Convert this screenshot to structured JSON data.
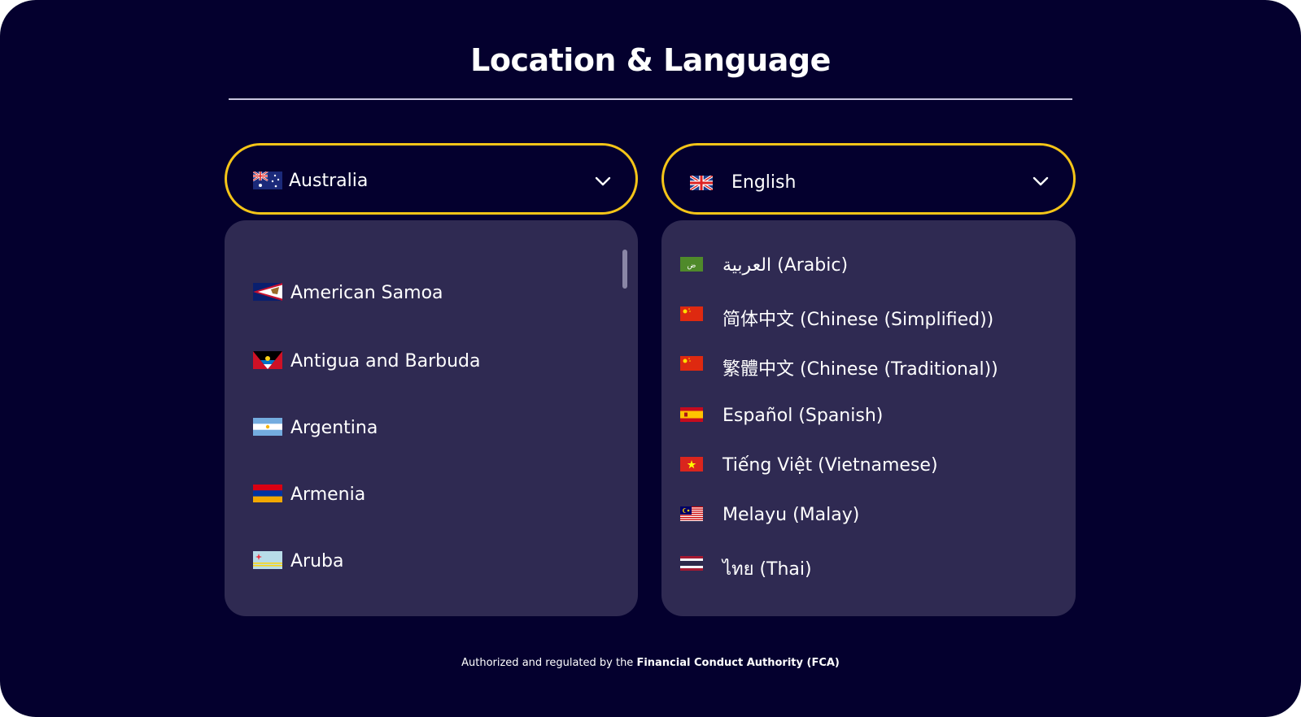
{
  "header": {
    "title": "Location & Language"
  },
  "country_select": {
    "selected": "Australia",
    "flag_icon": "australia-flag-icon"
  },
  "language_select": {
    "selected": "English",
    "flag_icon": "uk-flag-icon"
  },
  "country_list": {
    "items": [
      {
        "label": "American Samoa",
        "flag_icon": "american-samoa-flag-icon"
      },
      {
        "label": "Antigua and Barbuda",
        "flag_icon": "antigua-barbuda-flag-icon"
      },
      {
        "label": "Argentina",
        "flag_icon": "argentina-flag-icon"
      },
      {
        "label": "Armenia",
        "flag_icon": "armenia-flag-icon"
      },
      {
        "label": "Aruba",
        "flag_icon": "aruba-flag-icon"
      }
    ]
  },
  "language_list": {
    "items": [
      {
        "label": "العربية (Arabic)",
        "flag_icon": "arabic-flag-icon"
      },
      {
        "label": "简体中文 (Chinese (Simplified))",
        "flag_icon": "china-flag-icon"
      },
      {
        "label": "繁體中文 (Chinese (Traditional))",
        "flag_icon": "china-flag-icon"
      },
      {
        "label": "Español (Spanish)",
        "flag_icon": "spain-flag-icon"
      },
      {
        "label": "Tiếng Việt (Vietnamese)",
        "flag_icon": "vietnam-flag-icon"
      },
      {
        "label": "Melayu (Malay)",
        "flag_icon": "malaysia-flag-icon"
      },
      {
        "label": "ไทย (Thai)",
        "flag_icon": "thailand-flag-icon"
      }
    ]
  },
  "footer": {
    "prefix": "Authorized and regulated by the ",
    "authority": "Financial Conduct Authority (FCA)"
  },
  "colors": {
    "background": "#04002e",
    "panel": "#2f2a52",
    "accent_border": "#f5c518",
    "text": "#ffffff"
  }
}
